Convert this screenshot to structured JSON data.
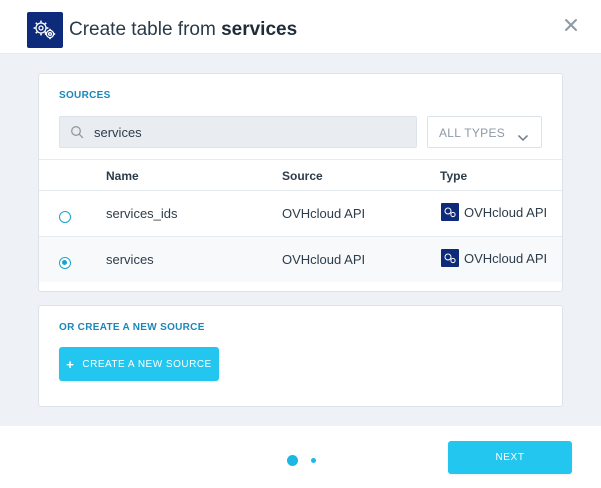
{
  "header": {
    "title_prefix": "Create table from ",
    "title_bold": "services",
    "icon": "gears-icon",
    "close_icon": "close-icon"
  },
  "sources": {
    "label": "SOURCES",
    "search": {
      "value": "services",
      "placeholder": ""
    },
    "types_filter": {
      "selected": "ALL TYPES"
    },
    "columns": [
      "Name",
      "Source",
      "Type"
    ],
    "rows": [
      {
        "name": "services_ids",
        "source": "OVHcloud API",
        "type": "OVHcloud API",
        "selected": false
      },
      {
        "name": "services",
        "source": "OVHcloud API",
        "type": "OVHcloud API",
        "selected": true
      }
    ]
  },
  "new_source": {
    "label": "OR CREATE A NEW SOURCE",
    "button_label": "CREATE A NEW SOURCE"
  },
  "footer": {
    "step_current": 1,
    "step_total": 2,
    "next_label": "NEXT"
  },
  "colors": {
    "accent": "#23c6ee",
    "section_label": "#1b87b8",
    "brand_icon_bg": "#0e2a7a",
    "body_bg": "#eef2f6"
  }
}
